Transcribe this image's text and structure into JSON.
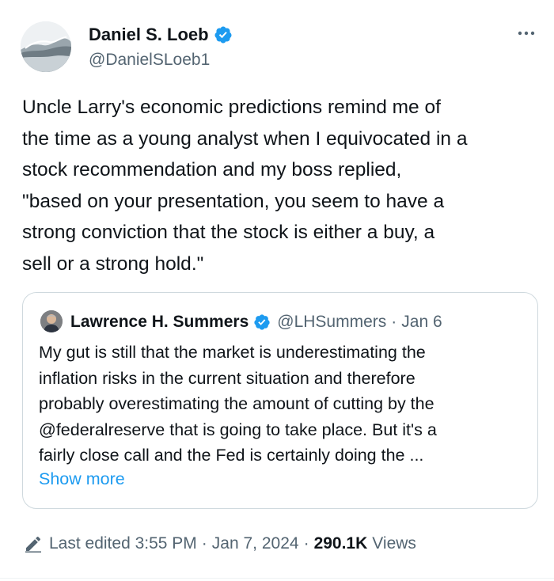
{
  "author": {
    "name": "Daniel S. Loeb",
    "handle": "@DanielSLoeb1",
    "verified": true,
    "avatar_icon": "wave-avatar"
  },
  "tweet": {
    "text": "Uncle Larry's economic predictions remind me of\nthe time as a young analyst when I equivocated in a\nstock recommendation and my boss replied,\n\"based on your presentation, you seem to have a\nstrong conviction that the stock is either a buy, a\nsell or a strong hold.\""
  },
  "quoted": {
    "name": "Lawrence H. Summers",
    "handle": "@LHSummers",
    "separator": "·",
    "date": "Jan 6",
    "verified": true,
    "text": "My gut is still that the market is underestimating the\ninflation risks in the current situation and therefore\nprobably overestimating the amount of cutting by the\n@federalreserve that is going to take place. But it's a\nfairly close call and the Fed is certainly doing the ...",
    "show_more": "Show more"
  },
  "meta": {
    "edited_label": "Last edited 3:55 PM",
    "separator": "·",
    "date": "Jan 7, 2024",
    "views_count": "290.1K",
    "views_label": "Views"
  },
  "colors": {
    "text": "#0f1419",
    "secondary": "#536471",
    "accent": "#1d9bf0",
    "border": "#cfd9de"
  }
}
